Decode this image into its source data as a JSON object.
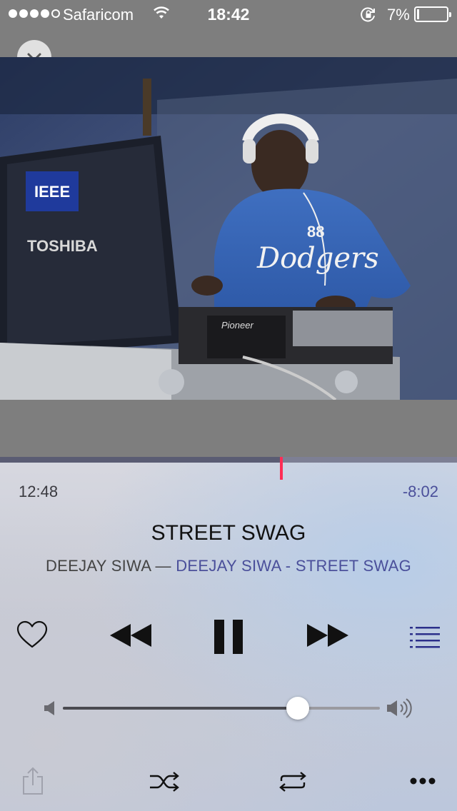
{
  "status_bar": {
    "carrier": "Safaricom",
    "time": "18:42",
    "battery_percent": "7%",
    "battery_level": 0.07,
    "signal_bars_filled": 4,
    "signal_bars_total": 5
  },
  "artwork": {
    "laptop_brand": "TOSHIBA",
    "sticker_text": "IEEE",
    "hoodie_text": "Dodgers",
    "hoodie_number": "88",
    "mixer_brand": "Pioneer"
  },
  "player": {
    "elapsed": "12:48",
    "remaining": "-8:02",
    "progress": 0.615,
    "title": "STREET SWAG",
    "artist": "DEEJAY SIWA",
    "separator": " — ",
    "album": "DEEJAY SIWA - STREET SWAG",
    "volume": 0.74,
    "accent_color": "#ff2d55",
    "link_color": "#4a4f9a"
  },
  "icons": {
    "collapse": "chevron-down-icon",
    "love": "heart-icon",
    "previous": "rewind-icon",
    "play_state": "pause-icon",
    "next": "fast-forward-icon",
    "up_next": "list-icon",
    "volume_low": "speaker-low-icon",
    "volume_high": "speaker-high-icon",
    "share": "share-icon",
    "shuffle": "shuffle-icon",
    "repeat": "repeat-icon",
    "more": "more-icon"
  }
}
